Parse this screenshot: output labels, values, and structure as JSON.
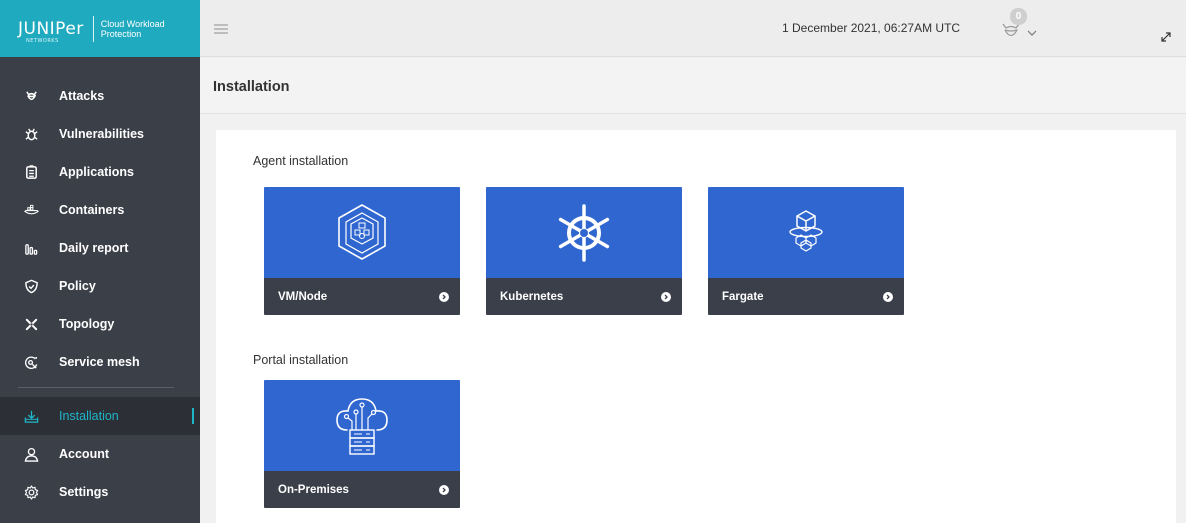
{
  "brand": {
    "logo": "JUNIPer",
    "logo_sub": "NETWORKS",
    "product": "Cloud Workload Protection"
  },
  "sidebar": {
    "items": [
      {
        "label": "Attacks",
        "icon": "attacks-icon"
      },
      {
        "label": "Vulnerabilities",
        "icon": "bug-icon"
      },
      {
        "label": "Applications",
        "icon": "applications-icon"
      },
      {
        "label": "Containers",
        "icon": "containers-icon"
      },
      {
        "label": "Daily report",
        "icon": "bar-chart-icon"
      },
      {
        "label": "Policy",
        "icon": "shield-icon"
      },
      {
        "label": "Topology",
        "icon": "topology-icon"
      },
      {
        "label": "Service mesh",
        "icon": "service-mesh-icon"
      }
    ],
    "bottom_items": [
      {
        "label": "Installation",
        "icon": "installation-icon",
        "active": true
      },
      {
        "label": "Account",
        "icon": "user-icon"
      },
      {
        "label": "Settings",
        "icon": "gear-icon"
      }
    ]
  },
  "topbar": {
    "datetime": "1 December 2021, 06:27AM UTC",
    "notification_count": "0"
  },
  "page": {
    "title": "Installation"
  },
  "sections": {
    "agent": {
      "label": "Agent installation",
      "tiles": [
        {
          "label": "VM/Node",
          "icon": "vm-node-icon"
        },
        {
          "label": "Kubernetes",
          "icon": "kubernetes-icon"
        },
        {
          "label": "Fargate",
          "icon": "fargate-icon"
        }
      ]
    },
    "portal": {
      "label": "Portal installation",
      "tiles": [
        {
          "label": "On-Premises",
          "icon": "on-premises-icon"
        }
      ]
    }
  },
  "colors": {
    "brand": "#1faabf",
    "sidebar": "#3b3f48",
    "tile_blue": "#2f66d0",
    "tile_dark": "#3a3f4a",
    "active": "#1fb5c9"
  }
}
